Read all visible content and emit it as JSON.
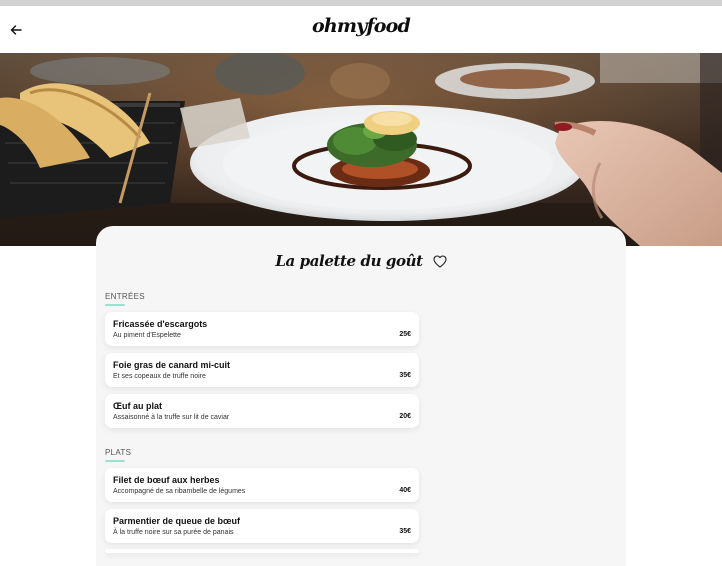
{
  "header": {
    "logo": "ohmyfood"
  },
  "restaurant": {
    "name": "La palette du goût"
  },
  "sections": [
    {
      "label": "ENTRÉES",
      "dishes": [
        {
          "name": "Fricassée d'escargots",
          "desc": "Au piment d'Espelette",
          "price": "25€"
        },
        {
          "name": "Foie gras de canard mi-cuit",
          "desc": "Et ses copeaux de truffe noire",
          "price": "35€"
        },
        {
          "name": "Œuf au plat",
          "desc": "Assaisonné à la truffe sur lit de caviar",
          "price": "20€"
        }
      ]
    },
    {
      "label": "PLATS",
      "dishes": [
        {
          "name": "Filet de bœuf aux herbes",
          "desc": "Accompagné de sa ribambelle de légumes",
          "price": "40€"
        },
        {
          "name": "Parmentier de queue de bœuf",
          "desc": "À la truffe noire sur sa purée de panais",
          "price": "35€"
        }
      ]
    }
  ],
  "icons": {
    "back": "arrow-left-icon",
    "favorite": "heart-outline-icon"
  },
  "colors": {
    "accent": "#99e2d0",
    "card_bg": "#f6f6f6"
  }
}
